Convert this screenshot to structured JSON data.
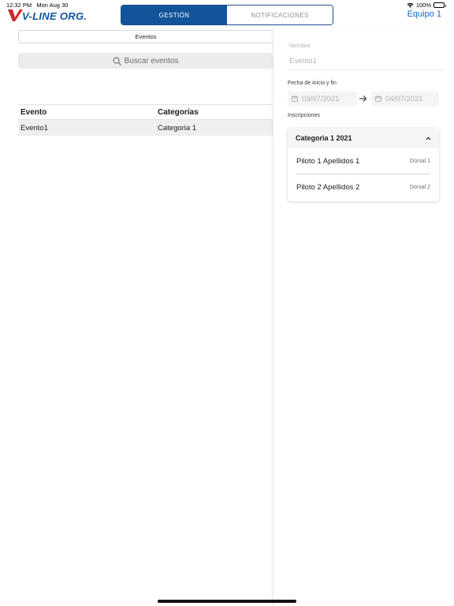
{
  "status_bar": {
    "time": "12:32 PM",
    "date": "Mon Aug 30",
    "battery": "100%",
    "icons": [
      "wifi-icon",
      "battery-icon"
    ]
  },
  "header": {
    "logo_text": "V-LINE ORG.",
    "tabs": [
      {
        "label": "GESTIÓN",
        "active": true
      },
      {
        "label": "NOTIFICACIONES",
        "active": false
      }
    ],
    "team_link": "Equipo 1",
    "accent_color": "#12549a",
    "logo_color": "#d0262d"
  },
  "left": {
    "section_tab": "Eventos",
    "search": {
      "placeholder": "Buscar eventos",
      "icon": "search-icon"
    },
    "table": {
      "columns": [
        "Evento",
        "Categorías"
      ],
      "rows": [
        [
          "Evento1",
          "Categoria 1"
        ]
      ]
    }
  },
  "detail": {
    "nombre_label": "Nombre",
    "nombre_value": "Evento1",
    "fechas_label": "Fecha de inicio y fin",
    "fecha_inicio": "03/07/2021",
    "fecha_fin": "04/07/2021",
    "inscripciones_label": "Inscripciones",
    "categoria": {
      "title": "Categoria 1 2021",
      "expanded": true,
      "pilots": [
        {
          "name": "Piloto 1 Apellidos 1",
          "dorsal": "Dorsal 1"
        },
        {
          "name": "Piloto 2 Apellidos 2",
          "dorsal": "Dorsal 2"
        }
      ]
    }
  }
}
